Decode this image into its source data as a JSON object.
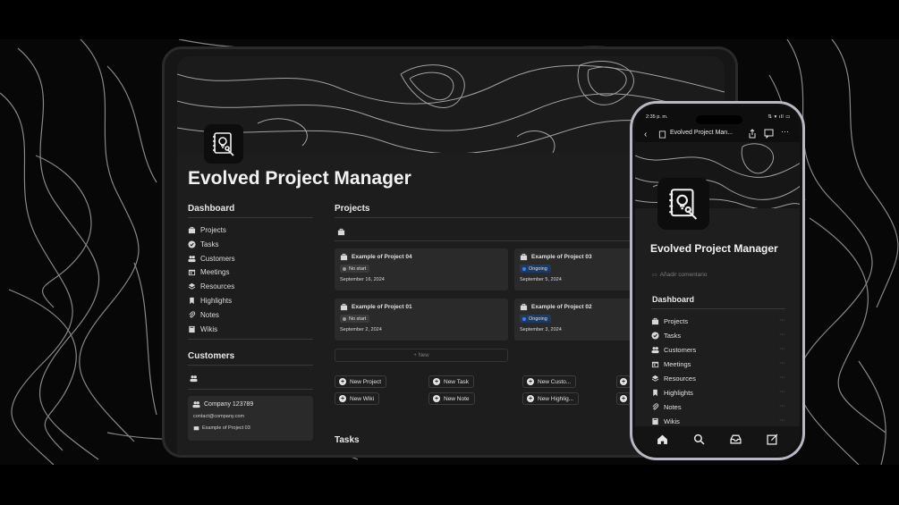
{
  "tablet": {
    "page_title": "Evolved Project Manager",
    "dashboard": {
      "heading": "Dashboard",
      "items": [
        {
          "label": "Projects",
          "icon": "briefcase-icon"
        },
        {
          "label": "Tasks",
          "icon": "check-circle-icon"
        },
        {
          "label": "Customers",
          "icon": "people-icon"
        },
        {
          "label": "Meetings",
          "icon": "calendar-icon"
        },
        {
          "label": "Resources",
          "icon": "layers-icon"
        },
        {
          "label": "Highlights",
          "icon": "bookmark-icon"
        },
        {
          "label": "Notes",
          "icon": "paperclip-icon"
        },
        {
          "label": "Wikis",
          "icon": "book-icon"
        }
      ]
    },
    "customers": {
      "heading": "Customers",
      "card": {
        "name": "Company 123789",
        "email": "contact@company.com",
        "project": "Example of Project 03"
      }
    },
    "projects": {
      "heading": "Projects",
      "cards": [
        {
          "title": "Example of Project 04",
          "status": "No start",
          "status_color": "#8a8a8a",
          "date": "September 16, 2024"
        },
        {
          "title": "Example of Project 03",
          "status": "Ongoing",
          "status_color": "#3b82f6",
          "date": "September 5, 2024"
        },
        {
          "title": "Example of Project 01",
          "status": "No start",
          "status_color": "#8a8a8a",
          "date": "September 2, 2024"
        },
        {
          "title": "Example of Project 02",
          "status": "Ongoing",
          "status_color": "#3b82f6",
          "date": "September 3, 2024"
        }
      ],
      "new_label": "+ New"
    },
    "actions": [
      {
        "label": "New Project"
      },
      {
        "label": "New Task"
      },
      {
        "label": "New Custo..."
      },
      {
        "label": "New Wiki"
      },
      {
        "label": "New Note"
      },
      {
        "label": "New Highlig..."
      }
    ],
    "tasks_heading": "Tasks"
  },
  "phone": {
    "time": "2:35 p. m.",
    "status_icons": "⇅ ▾ ıll ▭",
    "breadcrumb": "Evolved Project Man...",
    "page_title": "Evolved Project Manager",
    "add_comment": "Añadir comentario",
    "dashboard_heading": "Dashboard",
    "items": [
      {
        "label": "Projects",
        "icon": "briefcase-icon"
      },
      {
        "label": "Tasks",
        "icon": "check-circle-icon"
      },
      {
        "label": "Customers",
        "icon": "people-icon"
      },
      {
        "label": "Meetings",
        "icon": "calendar-icon"
      },
      {
        "label": "Resources",
        "icon": "layers-icon"
      },
      {
        "label": "Highlights",
        "icon": "bookmark-icon"
      },
      {
        "label": "Notes",
        "icon": "paperclip-icon"
      },
      {
        "label": "Wikis",
        "icon": "book-icon"
      }
    ],
    "more": "···",
    "tabbar": [
      "home-icon",
      "search-icon",
      "inbox-icon",
      "compose-icon"
    ]
  }
}
